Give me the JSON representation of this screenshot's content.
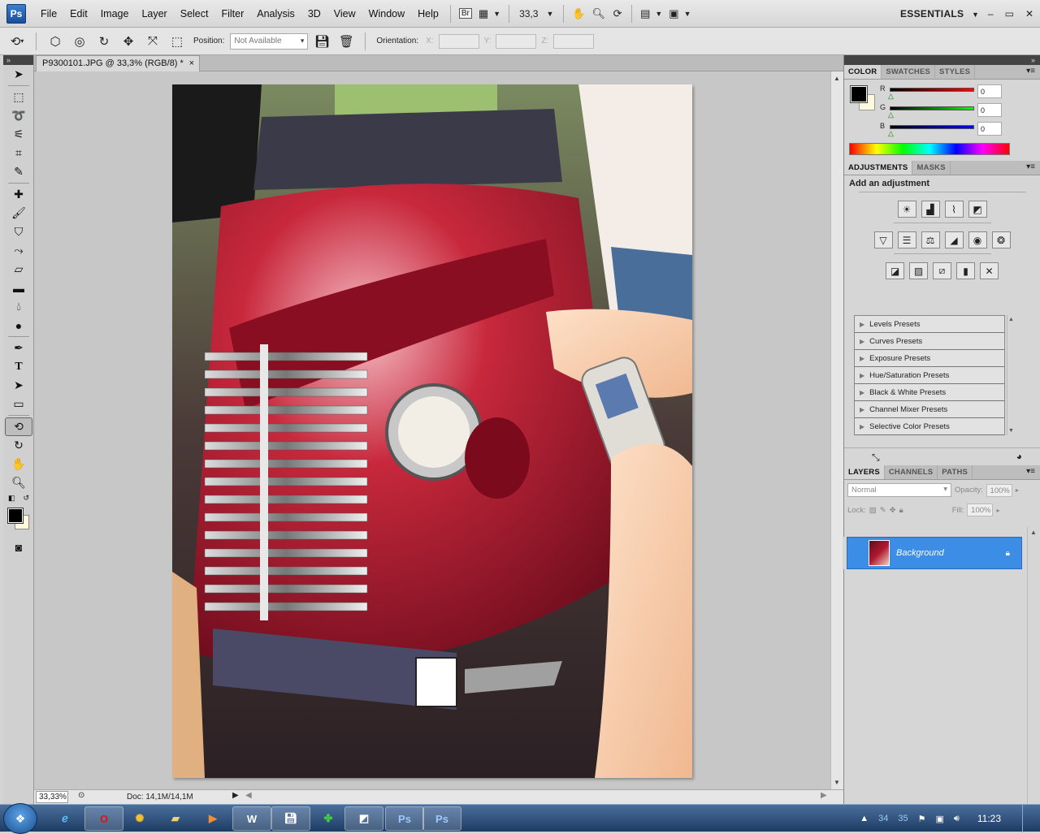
{
  "app": {
    "logo": "Ps",
    "menu": [
      "File",
      "Edit",
      "Image",
      "Layer",
      "Select",
      "Filter",
      "Analysis",
      "3D",
      "View",
      "Window",
      "Help"
    ],
    "bridge_label": "Br",
    "zoom_value": "33,3",
    "workspace": "ESSENTIALS",
    "window_buttons": {
      "minimize": "–",
      "restore": "▭",
      "close": "✕"
    }
  },
  "options": {
    "position_label": "Position:",
    "position_value": "Not Available",
    "orientation_label": "Orientation:",
    "x_label": "X:",
    "y_label": "Y:",
    "z_label": "Z:"
  },
  "document": {
    "tab_title": "P9300101.JPG @ 33,3% (RGB/8) *",
    "close": "×",
    "zoom_status": "33,33%",
    "doc_info": "Doc: 14,1M/14,1M"
  },
  "color_panel": {
    "tabs": [
      "COLOR",
      "SWATCHES",
      "STYLES"
    ],
    "r_label": "R",
    "g_label": "G",
    "b_label": "B",
    "r": "0",
    "g": "0",
    "b": "0",
    "foreground": "#000000",
    "background": "#fff8dc"
  },
  "adjustments_panel": {
    "tabs": [
      "ADJUSTMENTS",
      "MASKS"
    ],
    "title": "Add an adjustment",
    "presets": [
      "Levels Presets",
      "Curves Presets",
      "Exposure Presets",
      "Hue/Saturation Presets",
      "Black & White Presets",
      "Channel Mixer Presets",
      "Selective Color Presets"
    ]
  },
  "layers_panel": {
    "tabs": [
      "LAYERS",
      "CHANNELS",
      "PATHS"
    ],
    "blend_mode": "Normal",
    "opacity_label": "Opacity:",
    "opacity": "100%",
    "lock_label": "Lock:",
    "fill_label": "Fill:",
    "fill": "100%",
    "layer_name": "Background",
    "selection_color": "#3b8de6"
  },
  "taskbar": {
    "items": [
      "ie",
      "opera",
      "chrome",
      "explorer",
      "media",
      "word",
      "save",
      "clover",
      "app",
      "Ps",
      "Ps"
    ],
    "tray_numbers": [
      "34",
      "35"
    ],
    "clock": "11:23"
  }
}
